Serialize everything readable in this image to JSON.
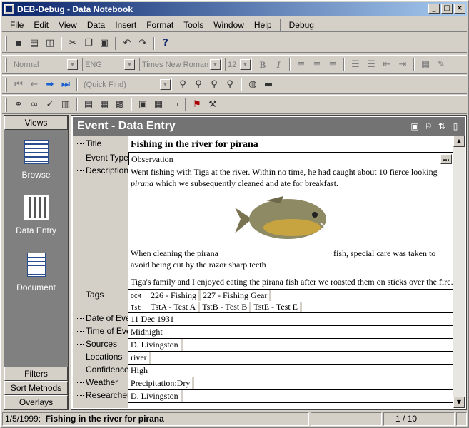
{
  "window": {
    "title": "DEB-Debug - Data Notebook",
    "min": "_",
    "max": "□",
    "close": "×"
  },
  "menu": [
    "File",
    "Edit",
    "View",
    "Data",
    "Insert",
    "Format",
    "Tools",
    "Window",
    "Help"
  ],
  "menu_extra": "Debug",
  "format": {
    "style": "Normal",
    "lang": "ENG",
    "font": "Times New Roman",
    "size": "12",
    "bold": "B",
    "italic": "I"
  },
  "find": {
    "placeholder": "(Quick Find)"
  },
  "views": {
    "header": "Views",
    "items": [
      {
        "label": "Browse"
      },
      {
        "label": "Data Entry"
      },
      {
        "label": "Document"
      }
    ],
    "footer": [
      "Filters",
      "Sort Methods",
      "Overlays"
    ]
  },
  "panel": {
    "title": "Event - Data Entry"
  },
  "fields": {
    "title_label": "Title",
    "title": "Fishing in the river for pirana",
    "event_type_label": "Event Type",
    "event_type": "Observation",
    "ellipsis": "...",
    "description_label": "Description",
    "desc_p1a": "Went fishing with Tiga at the river.  Within no time, he had caught about 10 fierce looking ",
    "desc_p1_italic": "pirana",
    "desc_p1b": " which we subsequently cleaned and ate for breakfast.",
    "desc_p2a": "When cleaning the pirana",
    "desc_p2b": "fish, special care was taken to",
    "desc_p2c": "avoid being cut by the razor sharp teeth",
    "desc_p3": "Tiga's family and I enjoyed eating the pirana fish after we roasted them on sticks over the fire.",
    "tags_label": "Tags",
    "tags": [
      {
        "code": "OCM",
        "items": [
          "226 - Fishing",
          "227 - Fishing Gear"
        ]
      },
      {
        "code": "Tst",
        "items": [
          "TstA - Test A",
          "TstB - Test B",
          "TstE - Test E"
        ]
      }
    ],
    "date_label": "Date of Eve",
    "date": "11 Dec 1931",
    "time_label": "Time of Eve",
    "time": "Midnight",
    "sources_label": "Sources",
    "sources": "D. Livingston",
    "locations_label": "Locations",
    "locations": "river",
    "confidence_label": "Confidence",
    "confidence": "High",
    "weather_label": "Weather",
    "weather": "Precipitation:Dry",
    "researcher_label": "Researcher",
    "researcher": "D. Livingston"
  },
  "status": {
    "left": "1/5/1999:",
    "left_bold": "Fishing in the river for pirana",
    "count": "1 / 10"
  }
}
